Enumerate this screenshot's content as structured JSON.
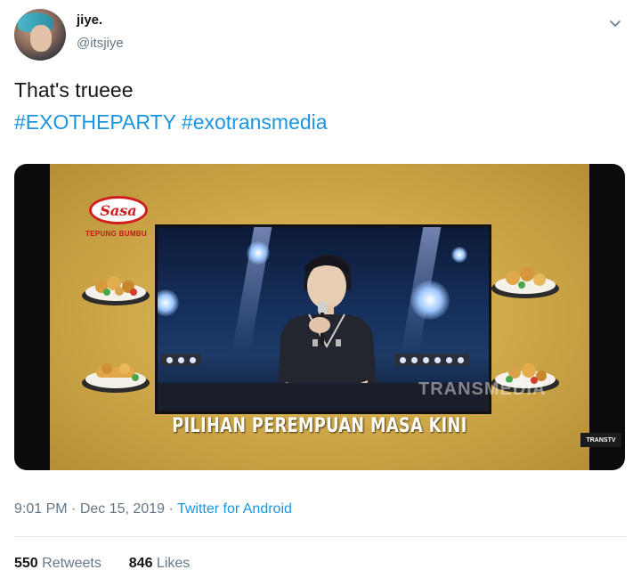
{
  "user": {
    "display_name": "jiye.",
    "handle": "@itsjiye"
  },
  "tweet": {
    "text": "That's trueee",
    "hashtags": [
      "#EXOTHEPARTY",
      "#exotransmedia"
    ]
  },
  "media": {
    "brand_logo": "Sasa",
    "brand_subtitle": "TEPUNG BUMBU",
    "watermark": "TRANSMEDIA",
    "caption": "PILIHAN PEREMPUAN MASA KINI",
    "channel_logo": "TRANSTV"
  },
  "meta": {
    "time": "9:01 PM",
    "date": "Dec 15, 2019",
    "source": "Twitter for Android"
  },
  "stats": {
    "retweets_count": "550",
    "retweets_label": "Retweets",
    "likes_count": "846",
    "likes_label": "Likes"
  },
  "icons": {
    "menu": "chevron-down-icon"
  },
  "colors": {
    "link": "#1b95e0",
    "muted": "#657786",
    "text": "#14171a"
  }
}
